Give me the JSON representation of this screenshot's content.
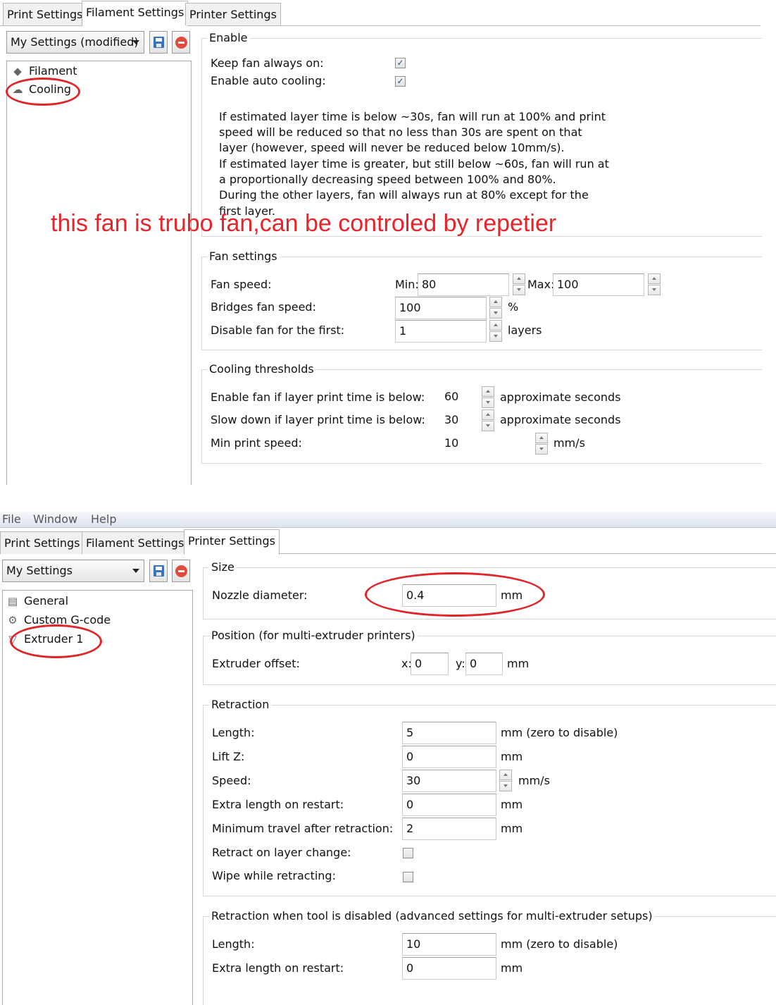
{
  "panel1": {
    "tabs": [
      "Print Settings",
      "Filament Settings",
      "Printer Settings"
    ],
    "active_tab": "Filament Settings",
    "preset": "My Settings (modified)",
    "tree": [
      {
        "label": "Filament",
        "icon": "filament-icon"
      },
      {
        "label": "Cooling",
        "icon": "cooling-icon"
      }
    ],
    "enable": {
      "title": "Enable",
      "keep_fan_label": "Keep fan always on:",
      "keep_fan_checked": "✓",
      "auto_cooling_label": "Enable auto cooling:",
      "auto_cooling_checked": "✓",
      "description": [
        "If estimated layer time is below ~30s, fan will run at 100% and print",
        "speed will be reduced so that no less than 30s are spent on that",
        "layer (however, speed will never be reduced below 10mm/s).",
        "If estimated layer time is greater, but still below ~60s, fan will run at",
        "a proportionally decreasing speed between 100% and 80%.",
        "During the other layers, fan will always run at 80% except for the",
        "first layer."
      ]
    },
    "annotation": "this fan is trubo fan,can be controled by repetier",
    "fan_settings": {
      "title": "Fan settings",
      "fan_speed_label": "Fan speed:",
      "min_label": "Min:",
      "min_value": "80",
      "max_label": "Max:",
      "max_value": "100",
      "bridges_label": "Bridges fan speed:",
      "bridges_value": "100",
      "bridges_unit": "%",
      "disable_label": "Disable fan for the first:",
      "disable_value": "1",
      "disable_unit": "layers"
    },
    "cooling_thresholds": {
      "title": "Cooling thresholds",
      "enable_label": "Enable fan if layer print time is below:",
      "enable_value": "60",
      "enable_unit": "approximate seconds",
      "slow_label": "Slow down if layer print time is below:",
      "slow_value": "30",
      "slow_unit": "approximate seconds",
      "min_speed_label": "Min print speed:",
      "min_speed_value": "10",
      "min_speed_unit": "mm/s"
    }
  },
  "panel2": {
    "menu": [
      "File",
      "Window",
      "Help"
    ],
    "tabs": [
      "Print Settings",
      "Filament Settings",
      "Printer Settings"
    ],
    "active_tab": "Printer Settings",
    "preset": "My Settings",
    "tree": [
      {
        "label": "General",
        "icon": "printer-icon"
      },
      {
        "label": "Custom G-code",
        "icon": "gear-icon"
      },
      {
        "label": "Extruder 1",
        "icon": "extruder-icon"
      }
    ],
    "size": {
      "title": "Size",
      "nozzle_label": "Nozzle diameter:",
      "nozzle_value": "0.4",
      "nozzle_unit": "mm"
    },
    "position": {
      "title": "Position (for multi-extruder printers)",
      "offset_label": "Extruder offset:",
      "x_label": "x:",
      "x_value": "0",
      "y_label": "y:",
      "y_value": "0",
      "unit": "mm"
    },
    "retraction": {
      "title": "Retraction",
      "rows": [
        {
          "label": "Length:",
          "value": "5",
          "unit": "mm (zero to disable)"
        },
        {
          "label": "Lift Z:",
          "value": "0",
          "unit": "mm"
        },
        {
          "label": "Speed:",
          "value": "30",
          "unit": "mm/s"
        },
        {
          "label": "Extra length on restart:",
          "value": "0",
          "unit": "mm"
        },
        {
          "label": "Minimum travel after retraction:",
          "value": "2",
          "unit": "mm"
        }
      ],
      "retract_layer_label": "Retract on layer change:",
      "wipe_label": "Wipe while retracting:"
    },
    "retraction_disabled": {
      "title": "Retraction when tool is disabled (advanced settings for multi-extruder setups)",
      "rows": [
        {
          "label": "Length:",
          "value": "10",
          "unit": "mm (zero to disable)"
        },
        {
          "label": "Extra length on restart:",
          "value": "0",
          "unit": "mm"
        }
      ]
    }
  }
}
